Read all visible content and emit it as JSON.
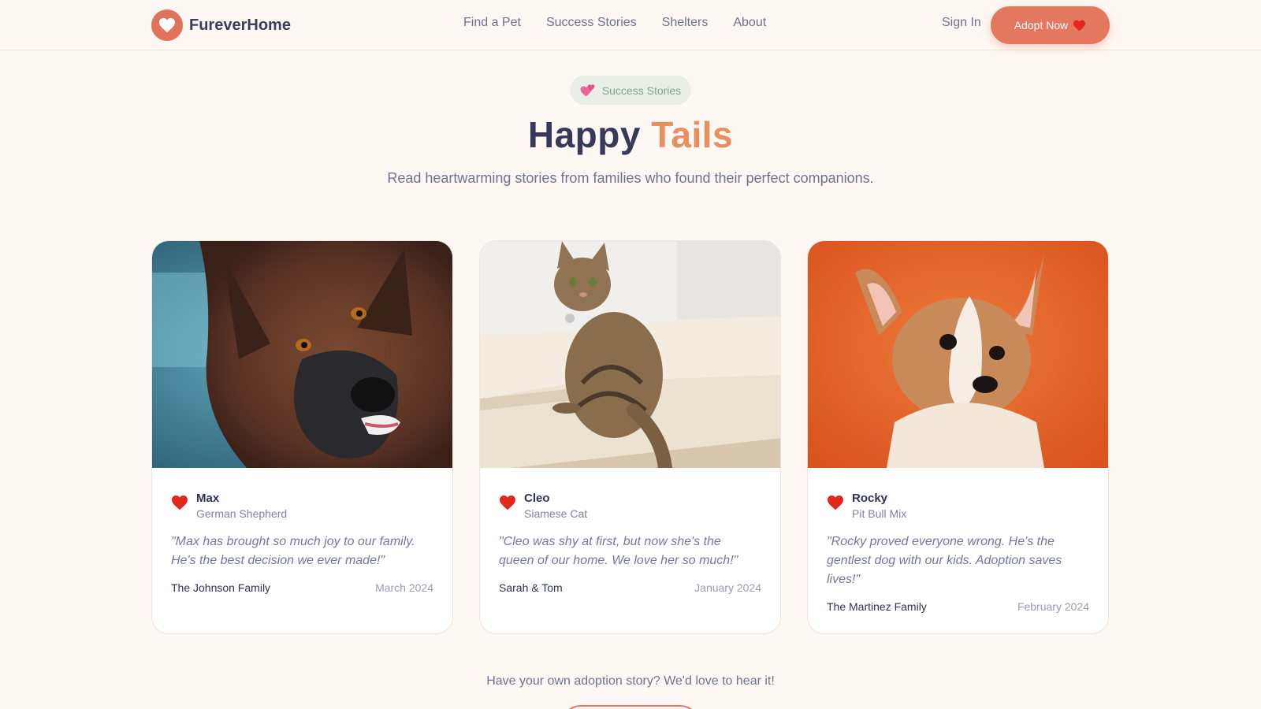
{
  "nav": {
    "brand": "FureverHome",
    "links": [
      "Find a Pet",
      "Success Stories",
      "Shelters",
      "About"
    ],
    "sign_in": "Sign In",
    "adopt_button": "Adopt Now"
  },
  "hero": {
    "badge_label": "Success Stories",
    "title_part1": "Happy",
    "title_part2": "Tails",
    "subtitle": "Read heartwarming stories from families who found their perfect companions."
  },
  "stories": [
    {
      "name": "Max",
      "breed": "German Shepherd",
      "quote": "\"Max has brought so much joy to our family. He's the best decision we ever made!\"",
      "family": "The Johnson Family",
      "date": "March 2024"
    },
    {
      "name": "Cleo",
      "breed": "Siamese Cat",
      "quote": "\"Cleo was shy at first, but now she's the queen of our home. We love her so much!\"",
      "family": "Sarah & Tom",
      "date": "January 2024"
    },
    {
      "name": "Rocky",
      "breed": "Pit Bull Mix",
      "quote": "\"Rocky proved everyone wrong. He's the gentlest dog with our kids. Adoption saves lives!\"",
      "family": "The Martinez Family",
      "date": "February 2024"
    }
  ],
  "cta": {
    "text": "Have your own adoption story? We'd love to hear it!"
  },
  "colors": {
    "accent": "#e3785f",
    "title_highlight": "#ea8f5c",
    "background": "#fdf8f4",
    "badge_bg": "#e9efe6"
  }
}
